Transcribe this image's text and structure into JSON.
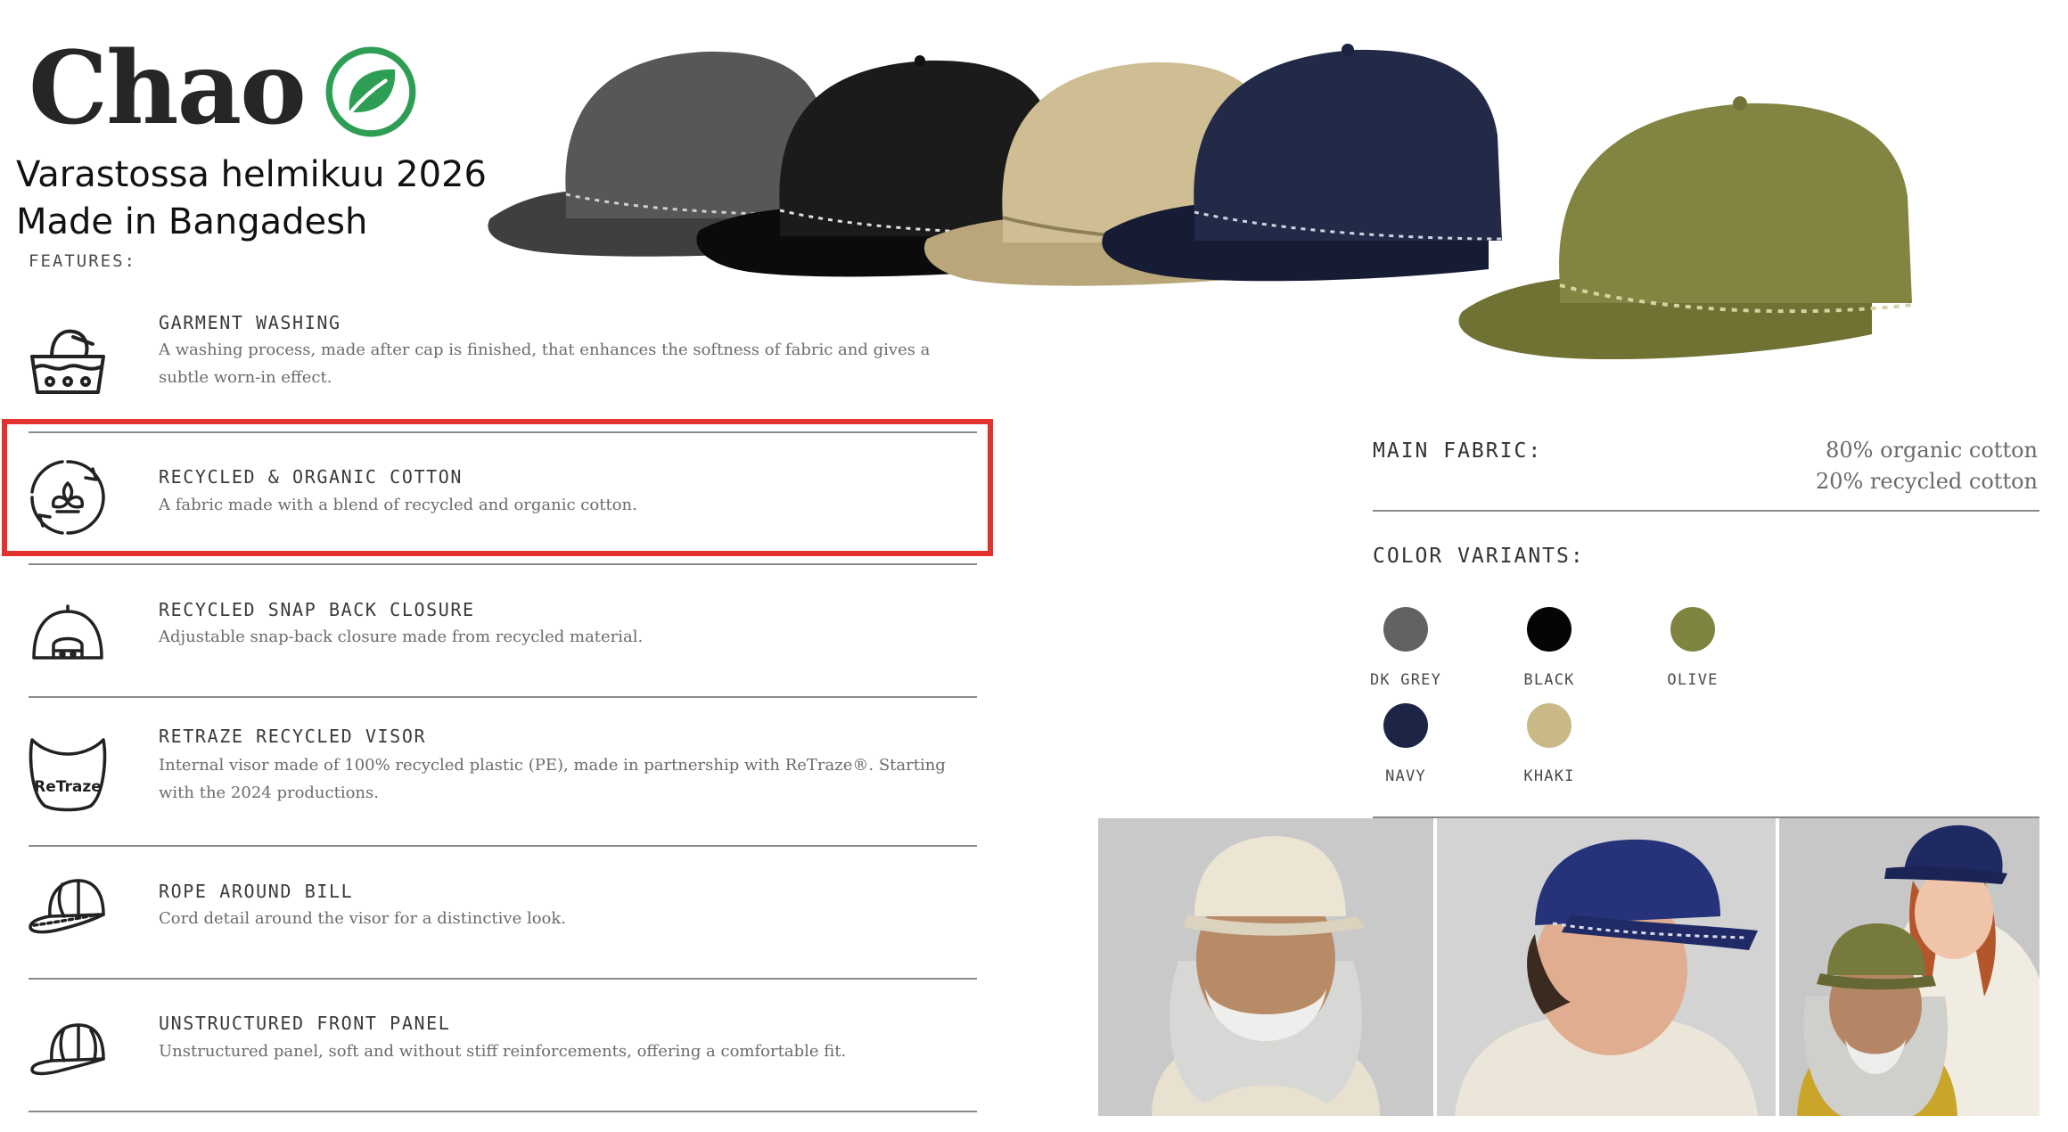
{
  "brand": {
    "name": "Chao",
    "logo_icon": "leaf-in-circle-icon",
    "logo_color": "#2f9e55"
  },
  "stock_note": {
    "line1": "Varastossa helmikuu 2026",
    "line2": "Made in Bangadesh"
  },
  "features": {
    "heading": "FEATURES:",
    "items": [
      {
        "icon": "washing-basin-icon",
        "title": "GARMENT WASHING",
        "description": "A washing process, made after cap is finished, that enhances the softness of fabric and gives a subtle worn-in effect."
      },
      {
        "icon": "cotton-recycle-icon",
        "title": "RECYCLED & ORGANIC COTTON",
        "description": "A fabric made with a blend of recycled and organic cotton.",
        "highlighted": true
      },
      {
        "icon": "snapback-closure-icon",
        "title": "RECYCLED SNAP BACK CLOSURE",
        "description": "Adjustable snap-back closure made from recycled material."
      },
      {
        "icon": "retraze-visor-icon",
        "icon_text": "ReTraze",
        "title": "RETRAZE RECYCLED VISOR",
        "description": "Internal visor made of 100% recycled plastic (PE), made in partnership with ReTraze®. Starting with the 2024 productions."
      },
      {
        "icon": "cap-rope-icon",
        "title": "ROPE AROUND BILL",
        "description": "Cord detail around the visor for a distinctive look."
      },
      {
        "icon": "cap-front-panel-icon",
        "title": "UNSTRUCTURED FRONT PANEL",
        "description": "Unstructured panel, soft and without stiff reinforcements, offering a comfortable fit."
      }
    ]
  },
  "highlight_color": "#e2322d",
  "main_fabric": {
    "label": "MAIN FABRIC:",
    "line1": "80% organic cotton",
    "line2": "20% recycled cotton"
  },
  "color_variants": {
    "label": "COLOR VARIANTS:",
    "items": [
      {
        "name": "DK GREY",
        "hex": "#626262"
      },
      {
        "name": "BLACK",
        "hex": "#050505"
      },
      {
        "name": "OLIVE",
        "hex": "#7f8441"
      },
      {
        "name": "NAVY",
        "hex": "#1c2546"
      },
      {
        "name": "KHAKI",
        "hex": "#c9b987"
      }
    ]
  },
  "product_caps": [
    "dark grey cap",
    "black cap",
    "khaki cap",
    "navy cap",
    "olive cap"
  ]
}
